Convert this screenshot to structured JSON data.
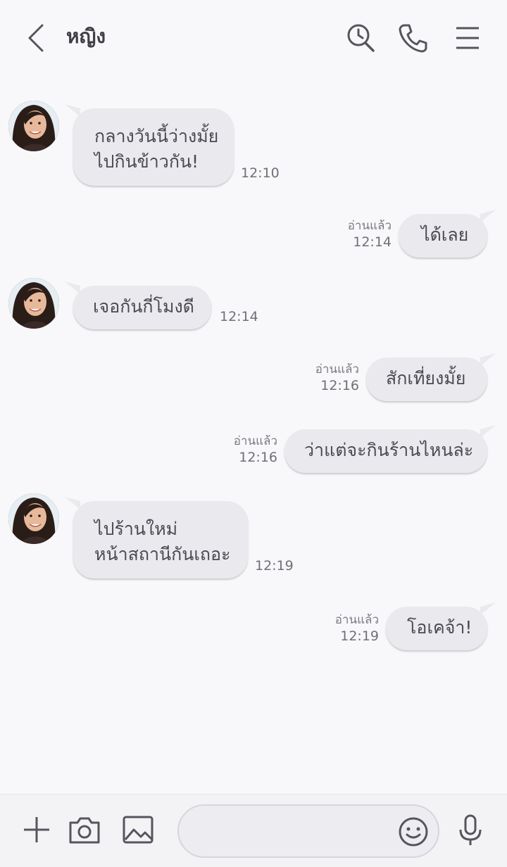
{
  "header": {
    "title": "หญิง",
    "icons": {
      "back": "chevron-left-icon",
      "search": "search-icon",
      "call": "phone-icon",
      "menu": "menu-icon"
    }
  },
  "messages": [
    {
      "side": "left",
      "lines": [
        "กลางวันนี้ว่างมั้ย",
        "ไปกินข้าวกัน!"
      ],
      "time": "12:10"
    },
    {
      "side": "right",
      "lines": [
        "ได้เลย"
      ],
      "time": "12:14",
      "read": "อ่านแล้ว"
    },
    {
      "side": "left",
      "lines": [
        "เจอกันกี่โมงดี"
      ],
      "time": "12:14"
    },
    {
      "side": "right",
      "lines": [
        "สักเที่ยงมั้ย"
      ],
      "time": "12:16",
      "read": "อ่านแล้ว"
    },
    {
      "side": "right",
      "lines": [
        "ว่าแต่จะกินร้านไหนล่ะ"
      ],
      "time": "12:16",
      "read": "อ่านแล้ว"
    },
    {
      "side": "left",
      "lines": [
        "ไปร้านใหม่",
        "หน้าสถานีกันเถอะ"
      ],
      "time": "12:19"
    },
    {
      "side": "right",
      "lines": [
        "โอเคจ้า!"
      ],
      "time": "12:19",
      "read": "อ่านแล้ว"
    }
  ],
  "composer": {
    "placeholder": "",
    "icons": {
      "add": "plus-icon",
      "camera": "camera-icon",
      "gallery": "image-icon",
      "emoji": "smiley-icon",
      "voice": "microphone-icon"
    }
  },
  "colors": {
    "background": "#f8f8fb",
    "bubble": "#e9e9ee",
    "text": "#4a4a52"
  }
}
